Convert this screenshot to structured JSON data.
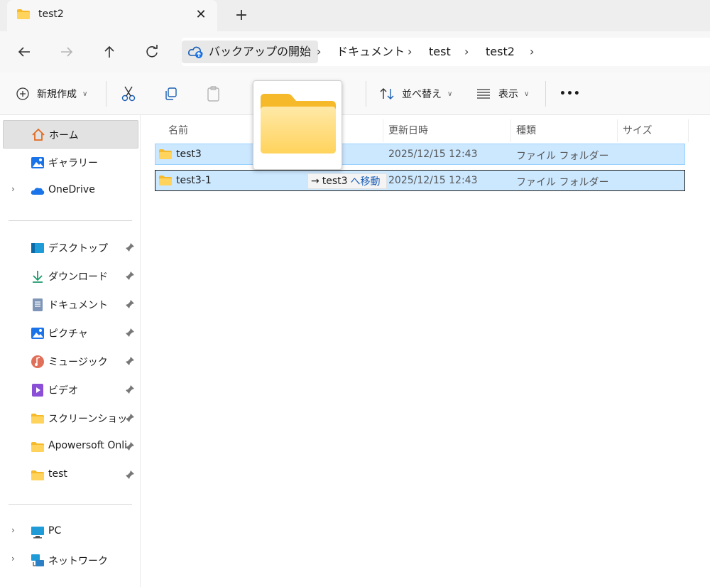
{
  "tab": {
    "title": "test2",
    "close_glyph": "✕",
    "new_tab_glyph": "+"
  },
  "address": {
    "root": "バックアップの開始",
    "crumbs": [
      "ドキュメント",
      "test",
      "test2"
    ],
    "separator": "›"
  },
  "commands": {
    "new": "新規作成",
    "sort": "並べ替え",
    "view": "表示",
    "more": "•••"
  },
  "sidebar": {
    "home": "ホーム",
    "gallery": "ギャラリー",
    "onedrive": "OneDrive",
    "desktop": "デスクトップ",
    "downloads": "ダウンロード",
    "documents": "ドキュメント",
    "pictures": "ピクチャ",
    "music": "ミュージック",
    "videos": "ビデオ",
    "screenshots": "スクリーンショット",
    "apowersoft": "Apowersoft Onli",
    "test": "test",
    "pc": "PC",
    "network": "ネットワーク",
    "expander": "›"
  },
  "columns": {
    "name": "名前",
    "modified": "更新日時",
    "type": "種類",
    "size": "サイズ"
  },
  "files": [
    {
      "name": "test3",
      "modified": "2025/12/15 12:43",
      "type": "ファイル フォルダー"
    },
    {
      "name": "test3-1",
      "modified": "2025/12/15 12:43",
      "type": "ファイル フォルダー"
    }
  ],
  "drag": {
    "target": "test3",
    "action": "へ移動"
  },
  "colors": {
    "selection": "#cce8ff",
    "selection_border": "#99d1ff",
    "folder": "#ffd35c",
    "accent": "#1b5fb8"
  }
}
